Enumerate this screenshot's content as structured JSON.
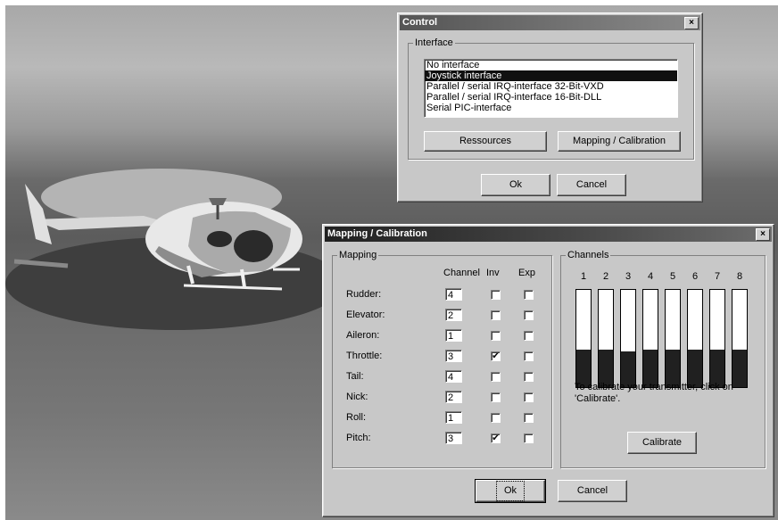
{
  "control_dialog": {
    "title": "Control",
    "close_glyph": "×",
    "interface_group_label": "Interface",
    "interface_options": [
      "No interface",
      "Joystick interface",
      "Parallel / serial IRQ-interface 32-Bit-VXD",
      "Parallel / serial IRQ-interface 16-Bit-DLL",
      "Serial PIC-interface"
    ],
    "selected_index": 1,
    "resources_label": "Ressources",
    "mapping_label": "Mapping / Calibration",
    "ok_label": "Ok",
    "cancel_label": "Cancel"
  },
  "mapping_dialog": {
    "title": "Mapping / Calibration",
    "close_glyph": "×",
    "mapping_group_label": "Mapping",
    "col_channel": "Channel",
    "col_inv": "Inv",
    "col_exp": "Exp",
    "rows": [
      {
        "label": "Rudder:",
        "channel": "4",
        "inv": false,
        "exp": false
      },
      {
        "label": "Elevator:",
        "channel": "2",
        "inv": false,
        "exp": false
      },
      {
        "label": "Aileron:",
        "channel": "1",
        "inv": false,
        "exp": false
      },
      {
        "label": "Throttle:",
        "channel": "3",
        "inv": true,
        "exp": false
      },
      {
        "label": "Tail:",
        "channel": "4",
        "inv": false,
        "exp": false
      },
      {
        "label": "Nick:",
        "channel": "2",
        "inv": false,
        "exp": false
      },
      {
        "label": "Roll:",
        "channel": "1",
        "inv": false,
        "exp": false
      },
      {
        "label": "Pitch:",
        "channel": "3",
        "inv": true,
        "exp": false
      }
    ],
    "channels_group_label": "Channels",
    "channel_numbers": [
      "1",
      "2",
      "3",
      "4",
      "5",
      "6",
      "7",
      "8"
    ],
    "channel_levels": [
      0.39,
      0.39,
      0.37,
      0.39,
      0.39,
      0.39,
      0.39,
      0.39
    ],
    "calibrate_hint": "To calibrate your transmitter, click on 'Calibrate'.",
    "calibrate_label": "Calibrate",
    "ok_label": "Ok",
    "cancel_label": "Cancel"
  },
  "check_glyph": "✔"
}
